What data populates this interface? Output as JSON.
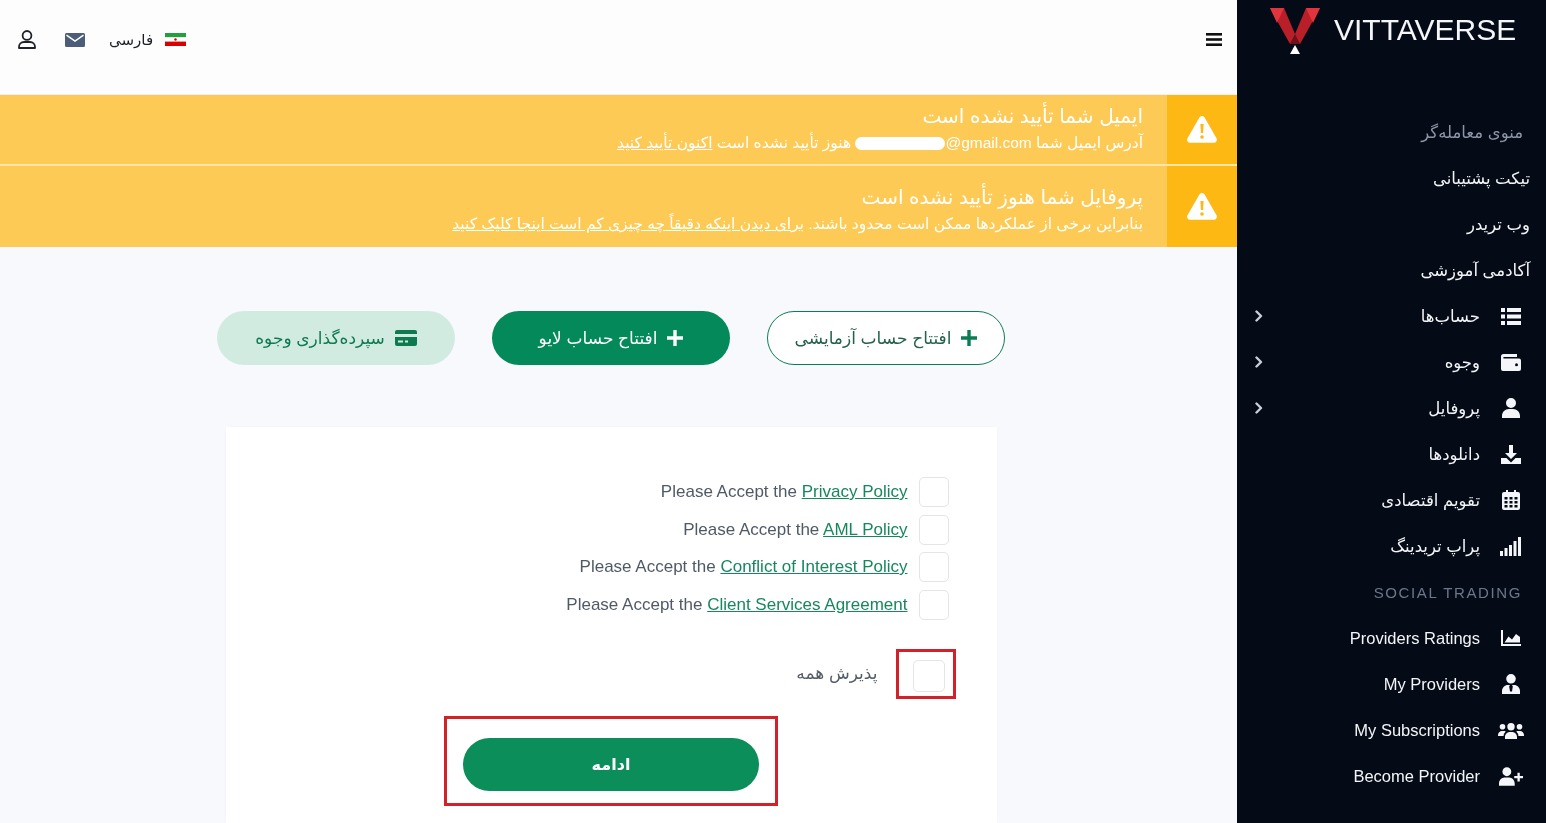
{
  "top_bar": {
    "language": "فارسی"
  },
  "alerts": [
    {
      "title": "ایمیل شما تأیید نشده است",
      "text": "آدرس ایمیل شما",
      "email": "@gmail.com",
      "email_redacted": true,
      "text_after": "هنوز تأیید نشده است",
      "link": "اکنون تأیید کنید"
    },
    {
      "title": "پروفایل شما هنوز تأیید نشده است",
      "text": "بنابراین برخی از عملکردها ممکن است محدود باشند.",
      "link": "برای دیدن اینکه دقیقاً چه چیزی کم است اینجا کلیک کنید"
    }
  ],
  "actions": [
    {
      "label": "افتتاح حساب آزمایشی",
      "kind": "outline"
    },
    {
      "label": "افتتاح حساب لایو",
      "kind": "solid"
    },
    {
      "label": "سپرده‌گذاری وجوه",
      "kind": "soft"
    }
  ],
  "agreements": [
    {
      "prefix": "Please Accept the",
      "link": "Privacy Policy",
      "checked": false
    },
    {
      "prefix": "Please Accept the",
      "link": "AML Policy",
      "checked": false
    },
    {
      "prefix": "Please Accept the",
      "link": "Conflict of Interest Policy",
      "checked": false
    },
    {
      "prefix": "Please Accept the",
      "link": "Client Services Agreement",
      "checked": false
    }
  ],
  "accept_all": {
    "label": "پذیرش همه",
    "checked": false,
    "highlighted": true
  },
  "continue_button": {
    "label": "ادامه",
    "highlighted": true
  },
  "sidebar": {
    "brand": "VITTAVERSE",
    "items": [
      {
        "kind": "heading",
        "label": "منوی معامله‌گر"
      },
      {
        "kind": "link",
        "label": "تیکت پشتیبانی",
        "has_submenu": false
      },
      {
        "kind": "link",
        "label": "وب تریدر",
        "has_submenu": false
      },
      {
        "kind": "link",
        "label": "آکادمی آموزشی",
        "has_submenu": false
      },
      {
        "kind": "icon_link",
        "label": "حساب‌ها",
        "has_submenu": true
      },
      {
        "kind": "icon_link",
        "label": "وجوه",
        "has_submenu": true
      },
      {
        "kind": "icon_link",
        "label": "پروفایل",
        "has_submenu": true
      },
      {
        "kind": "icon_link",
        "label": "دانلودها",
        "has_submenu": false
      },
      {
        "kind": "icon_link",
        "label": "تقویم اقتصادی",
        "has_submenu": false
      },
      {
        "kind": "icon_link",
        "label": "پراپ تریدینگ",
        "has_submenu": false
      },
      {
        "kind": "caps_heading",
        "label": "SOCIAL TRADING"
      },
      {
        "kind": "icon_link",
        "label": "Providers Ratings",
        "has_submenu": false
      },
      {
        "kind": "icon_link",
        "label": "My Providers",
        "has_submenu": false
      },
      {
        "kind": "icon_link",
        "label": "My Subscriptions",
        "has_submenu": false
      },
      {
        "kind": "icon_link",
        "label": "Become Provider",
        "has_submenu": false
      }
    ]
  }
}
